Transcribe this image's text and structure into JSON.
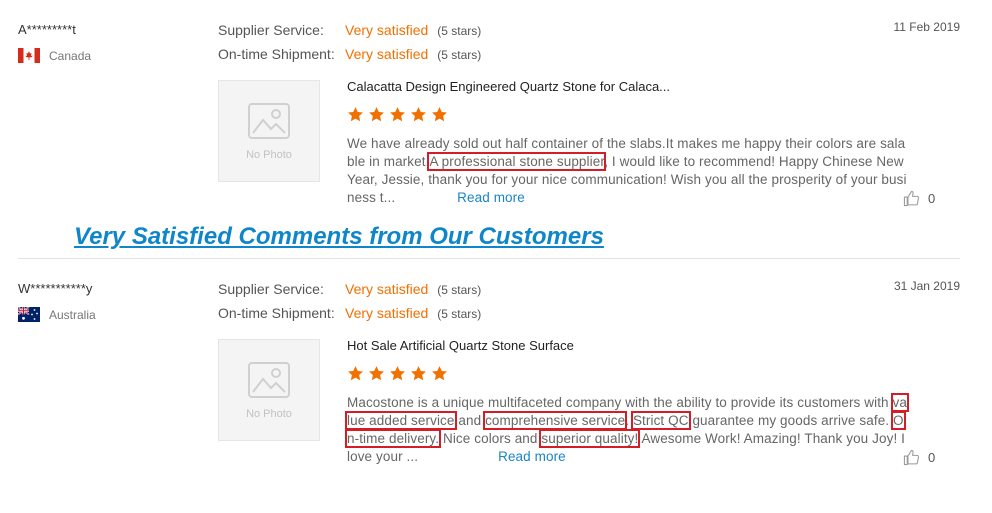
{
  "banner": "Very Satisfied Comments from Our Customers",
  "reviews": [
    {
      "user": "A*********t",
      "country": "Canada",
      "date": "11 Feb 2019",
      "supplier_service_label": "Supplier Service:",
      "supplier_service_value": "Very satisfied",
      "supplier_service_stars": "(5 stars)",
      "ontime_label": "On-time Shipment:",
      "ontime_value": "Very satisfied",
      "ontime_stars": "(5 stars)",
      "photo_placeholder": "No Photo",
      "product_title": "Calacatta Design Engineered Quartz Stone for Calaca...",
      "rating": 5,
      "comment": {
        "t1": "We have already sold out half container of the slabs.It makes me happy their colors are salable in market.",
        "h1": "A professional stone supplier",
        "t2": ", I would like to recommend! Happy Chinese New Year, Jessie, thank you for your nice communication! Wish you all the prosperity of your business t..."
      },
      "read_more": "Read more",
      "likes": "0"
    },
    {
      "user": "W***********y",
      "country": "Australia",
      "date": "31 Jan 2019",
      "supplier_service_label": "Supplier Service:",
      "supplier_service_value": "Very satisfied",
      "supplier_service_stars": "(5 stars)",
      "ontime_label": "On-time Shipment:",
      "ontime_value": "Very satisfied",
      "ontime_stars": "(5 stars)",
      "photo_placeholder": "No Photo",
      "product_title": "Hot Sale Artificial Quartz Stone Surface",
      "rating": 5,
      "comment": {
        "t1": "Macostone is a unique multifaceted company with the ability to provide its customers with ",
        "h1": "value added service",
        "t2": " and ",
        "h2": "comprehensive service",
        "t3": ". ",
        "h3": "Strict QC",
        "t4": " guarantee my goods arrive safe. ",
        "h4": "On-time delivery.",
        "t5": " Nice colors and ",
        "h5": "superior quality!",
        "t6": " Awesome Work! Amazing! Thank you Joy! I love your ..."
      },
      "read_more": "Read more",
      "likes": "0"
    }
  ],
  "colors": {
    "accent": "#f07000",
    "link": "#1a84c7",
    "highlight": "#d21e24",
    "banner": "#0f86c9"
  }
}
